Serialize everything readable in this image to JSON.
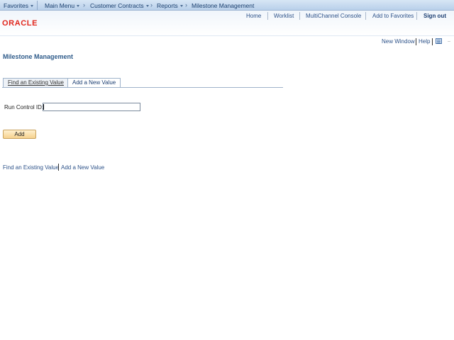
{
  "nav": {
    "favorites": "Favorites",
    "main_menu": "Main Menu",
    "crumb_1": "Customer Contracts",
    "crumb_2": "Reports",
    "crumb_3": "Milestone Management"
  },
  "brand": {
    "logo_text": "ORACLE",
    "logo_color": "#e1261c"
  },
  "header_links": {
    "home": "Home",
    "worklist": "Worklist",
    "multichannel": "MultiChannel Console",
    "add_favorites": "Add to Favorites",
    "sign_out": "Sign out"
  },
  "utility": {
    "new_window": "New Window",
    "help": "Help"
  },
  "page": {
    "title": "Milestone Management"
  },
  "tabs": [
    {
      "label": "Find an Existing Value",
      "active": false
    },
    {
      "label": "Add a New Value",
      "active": true
    }
  ],
  "form": {
    "run_control_label": "Run Control ID:",
    "run_control_value": "",
    "add_button": "Add"
  },
  "bottom_links": {
    "find": "Find an Existing Value",
    "add": "Add a New Value"
  },
  "colors": {
    "accent_blue": "#2d5289",
    "title_blue": "#2e5b8a",
    "button_fill": "#f6d28e"
  }
}
